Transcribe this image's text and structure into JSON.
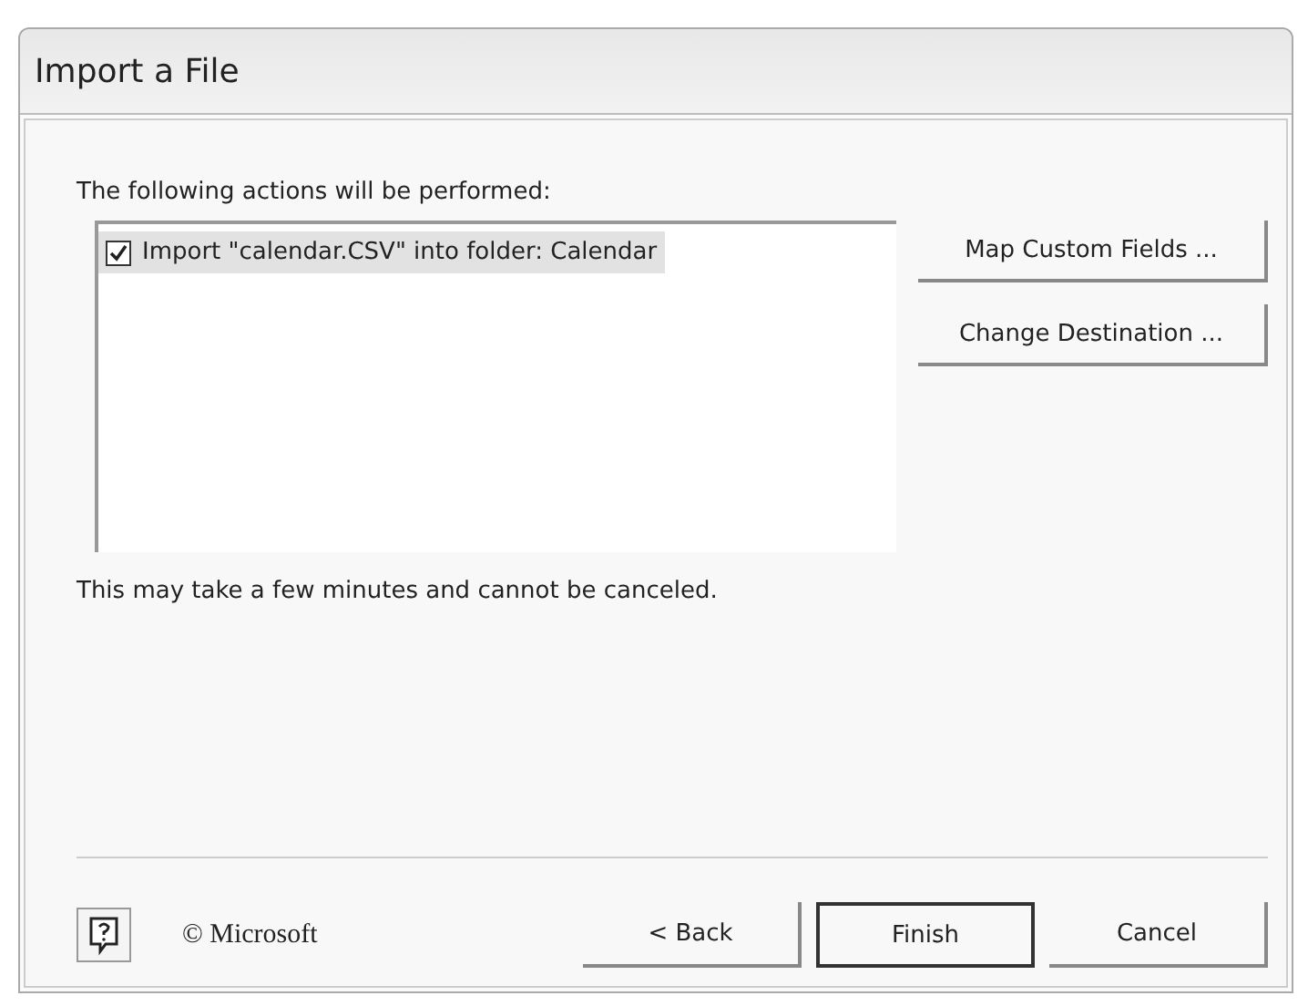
{
  "window": {
    "title": "Import a File"
  },
  "actions_label": "The following actions will be performed:",
  "actions": [
    {
      "label": "Import \"calendar.CSV\" into folder: Calendar",
      "checked": true,
      "selected": true
    }
  ],
  "side_buttons": [
    "Map Custom Fields ...",
    "Change Destination ..."
  ],
  "note": "This may take a few minutes and cannot be canceled.",
  "copyright": "© Microsoft",
  "buttons": [
    {
      "label": "< Back",
      "default": false
    },
    {
      "label": "Finish",
      "default": true
    },
    {
      "label": "Cancel",
      "default": false
    }
  ]
}
